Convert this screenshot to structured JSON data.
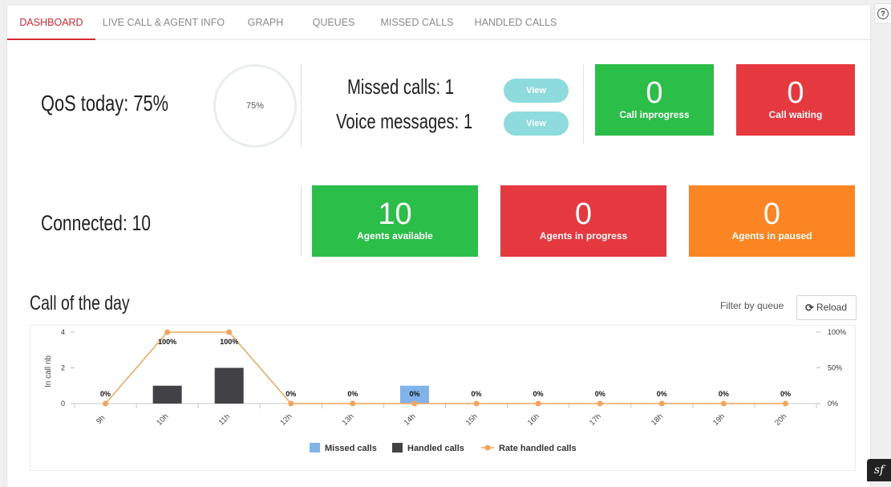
{
  "tabs": [
    {
      "label": "DASHBOARD",
      "active": true
    },
    {
      "label": "LIVE CALL & AGENT INFO",
      "active": false
    },
    {
      "label": "GRAPH",
      "active": false
    },
    {
      "label": "QUEUES",
      "active": false
    },
    {
      "label": "MISSED CALLS",
      "active": false
    },
    {
      "label": "HANDLED CALLS",
      "active": false
    }
  ],
  "help": {
    "glyph": "?",
    "icon": "help-circle-icon"
  },
  "qos": {
    "label": "QoS today: 75%",
    "ring_text": "75%",
    "ring_value_pct": 75
  },
  "missed": {
    "missed_label": "Missed calls: 1",
    "voice_label": "Voice messages: 1",
    "view1": "View",
    "view2": "View"
  },
  "tiles_top": [
    {
      "value": "0",
      "label": "Call inprogress",
      "color": "#2bbf4a"
    },
    {
      "value": "0",
      "label": "Call waiting",
      "color": "#e5383f"
    }
  ],
  "connected": {
    "label": "Connected: 10"
  },
  "tiles_agents": [
    {
      "value": "10",
      "label": "Agents available",
      "color": "#2bbf4a"
    },
    {
      "value": "0",
      "label": "Agents in progress",
      "color": "#e5383f"
    },
    {
      "value": "0",
      "label": "Agents in paused",
      "color": "#fb8522"
    }
  ],
  "section": {
    "title": "Call of the day",
    "filter_label": "Filter by queue",
    "reload_label": "Reload",
    "reload_icon": "refresh-icon"
  },
  "colors": {
    "missed": "#7fb3ea",
    "handled": "#414146",
    "rate": "#f3a45a",
    "accent": "#d9282f"
  },
  "chart_data": {
    "type": "bar",
    "categories": [
      "9h",
      "10h",
      "11h",
      "12h",
      "13h",
      "14h",
      "15h",
      "16h",
      "17h",
      "18h",
      "19h",
      "20h"
    ],
    "series": [
      {
        "name": "Missed calls",
        "type": "bar",
        "axis": "left",
        "values": [
          0,
          0,
          0,
          0,
          0,
          1,
          0,
          0,
          0,
          0,
          0,
          0
        ]
      },
      {
        "name": "Handled calls",
        "type": "bar",
        "axis": "left",
        "values": [
          0,
          1,
          2,
          0,
          0,
          0,
          0,
          0,
          0,
          0,
          0,
          0
        ]
      },
      {
        "name": "Rate handled calls",
        "type": "line",
        "axis": "right",
        "values": [
          0,
          100,
          100,
          0,
          0,
          0,
          0,
          0,
          0,
          0,
          0,
          0
        ]
      }
    ],
    "data_labels": [
      "0%",
      "100%",
      "100%",
      "0%",
      "0%",
      "0%",
      "0%",
      "0%",
      "0%",
      "0%",
      "0%",
      "0%"
    ],
    "ylabel": "In call nb",
    "ylim": [
      0,
      4
    ],
    "yticks": [
      "0",
      "2",
      "4"
    ],
    "y2lim": [
      0,
      100
    ],
    "y2ticks": [
      "0%",
      "50%",
      "100%"
    ],
    "legend": "bottom-center"
  },
  "framework_badge": {
    "glyph": "sf",
    "icon": "symfony-logo-icon"
  }
}
